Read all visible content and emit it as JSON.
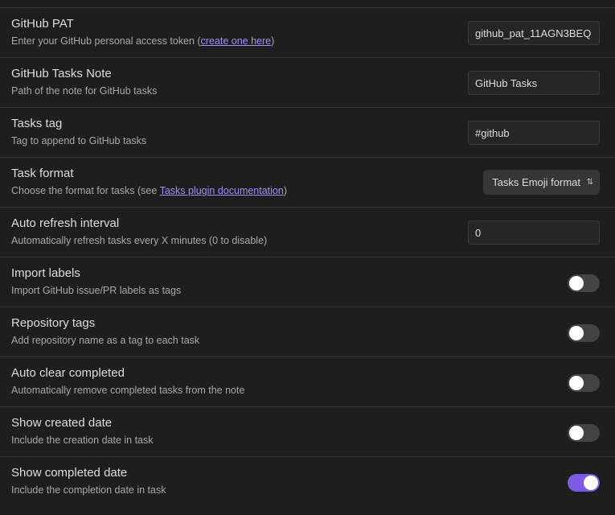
{
  "settings": [
    {
      "name": "GitHub PAT",
      "desc_prefix": "Enter your GitHub personal access token (",
      "link": "create one here",
      "desc_suffix": ")",
      "value": "github_pat_11AGN3BEQ"
    },
    {
      "name": "GitHub Tasks Note",
      "desc": "Path of the note for GitHub tasks",
      "value": "GitHub Tasks"
    },
    {
      "name": "Tasks tag",
      "desc": "Tag to append to GitHub tasks",
      "value": "#github"
    },
    {
      "name": "Task format",
      "desc_prefix": "Choose the format for tasks (see ",
      "link": "Tasks plugin documentation",
      "desc_suffix": ")",
      "selected": "Tasks Emoji format"
    },
    {
      "name": "Auto refresh interval",
      "desc": "Automatically refresh tasks every X minutes (0 to disable)",
      "value": "0"
    },
    {
      "name": "Import labels",
      "desc": "Import GitHub issue/PR labels as tags",
      "enabled": false
    },
    {
      "name": "Repository tags",
      "desc": "Add repository name as a tag to each task",
      "enabled": false
    },
    {
      "name": "Auto clear completed",
      "desc": "Automatically remove completed tasks from the note",
      "enabled": false
    },
    {
      "name": "Show created date",
      "desc": "Include the creation date in task",
      "enabled": false
    },
    {
      "name": "Show completed date",
      "desc": "Include the completion date in task",
      "enabled": true
    }
  ],
  "icons": {
    "dropdown_chevron": "chevron-up-down-icon"
  },
  "colors": {
    "accent": "#7c5ce6",
    "link": "#a78bfa",
    "background": "#1e1e1e"
  }
}
